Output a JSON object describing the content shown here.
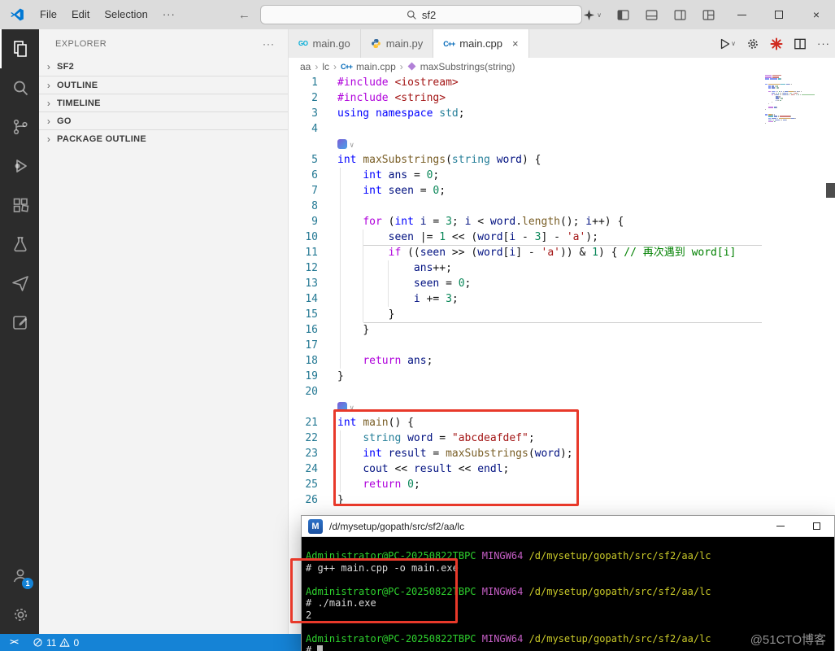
{
  "colors": {
    "accent_red": "#e8392a",
    "status_blue": "#1583d6",
    "activity_bar": "#2c2c2c",
    "term_green": "#2ed22e",
    "term_magenta": "#c75fc7",
    "term_yellow": "#c9c929",
    "term_fg": "#d9d9d9",
    "go_icon": "#00acd7",
    "cpp_icon": "#0068b8"
  },
  "icons": {
    "more": "···",
    "back": "←",
    "forward": "→",
    "close": "×",
    "chevron": "›",
    "crumb_sep": "›",
    "chevron_down": "∨",
    "remote": "><",
    "mingw": "M",
    "go": "GO",
    "cpp": "C++"
  },
  "title_bar": {
    "menus": [
      "File",
      "Edit",
      "Selection"
    ],
    "search_value": "sf2"
  },
  "activity_bar": {
    "badge": "1"
  },
  "sidebar": {
    "header": "EXPLORER",
    "sections": [
      "SF2",
      "OUTLINE",
      "TIMELINE",
      "GO",
      "PACKAGE OUTLINE"
    ]
  },
  "tabs": [
    {
      "label": "main.go"
    },
    {
      "label": "main.py"
    },
    {
      "label": "main.cpp",
      "active": true
    }
  ],
  "breadcrumb": [
    "aa",
    "lc",
    "main.cpp",
    "maxSubstrings(string)"
  ],
  "editor": {
    "rows": [
      {
        "n": 1,
        "t": [
          [
            "dir",
            "#include"
          ],
          [
            "pln",
            " "
          ],
          [
            "str",
            "<iostream>"
          ]
        ]
      },
      {
        "n": 2,
        "t": [
          [
            "dir",
            "#include"
          ],
          [
            "pln",
            " "
          ],
          [
            "str",
            "<string>"
          ]
        ]
      },
      {
        "n": 3,
        "t": [
          [
            "kw",
            "using"
          ],
          [
            "pln",
            " "
          ],
          [
            "kw",
            "namespace"
          ],
          [
            "pln",
            " "
          ],
          [
            "type",
            "std"
          ],
          [
            "pun",
            ";"
          ]
        ]
      },
      {
        "n": 4,
        "t": []
      },
      {
        "lens": true
      },
      {
        "n": 5,
        "t": [
          [
            "kw",
            "int"
          ],
          [
            "pln",
            " "
          ],
          [
            "fn",
            "maxSubstrings"
          ],
          [
            "pun",
            "("
          ],
          [
            "type",
            "string"
          ],
          [
            "pln",
            " "
          ],
          [
            "var",
            "word"
          ],
          [
            "pun",
            ")"
          ],
          [
            "pln",
            " "
          ],
          [
            "pun",
            "{"
          ]
        ]
      },
      {
        "n": 6,
        "t": [
          [
            "pln",
            "    "
          ],
          [
            "kw",
            "int"
          ],
          [
            "pln",
            " "
          ],
          [
            "var",
            "ans"
          ],
          [
            "pln",
            " "
          ],
          [
            "op",
            "="
          ],
          [
            "pln",
            " "
          ],
          [
            "num",
            "0"
          ],
          [
            "pun",
            ";"
          ]
        ]
      },
      {
        "n": 7,
        "t": [
          [
            "pln",
            "    "
          ],
          [
            "kw",
            "int"
          ],
          [
            "pln",
            " "
          ],
          [
            "var",
            "seen"
          ],
          [
            "pln",
            " "
          ],
          [
            "op",
            "="
          ],
          [
            "pln",
            " "
          ],
          [
            "num",
            "0"
          ],
          [
            "pun",
            ";"
          ]
        ]
      },
      {
        "n": 8,
        "t": []
      },
      {
        "n": 9,
        "t": [
          [
            "pln",
            "    "
          ],
          [
            "ctl",
            "for"
          ],
          [
            "pln",
            " "
          ],
          [
            "pun",
            "("
          ],
          [
            "kw",
            "int"
          ],
          [
            "pln",
            " "
          ],
          [
            "var",
            "i"
          ],
          [
            "pln",
            " "
          ],
          [
            "op",
            "="
          ],
          [
            "pln",
            " "
          ],
          [
            "num",
            "3"
          ],
          [
            "pun",
            ";"
          ],
          [
            "pln",
            " "
          ],
          [
            "var",
            "i"
          ],
          [
            "pln",
            " "
          ],
          [
            "op",
            "<"
          ],
          [
            "pln",
            " "
          ],
          [
            "var",
            "word"
          ],
          [
            "pun",
            "."
          ],
          [
            "fn",
            "length"
          ],
          [
            "pun",
            "();"
          ],
          [
            "pln",
            " "
          ],
          [
            "var",
            "i"
          ],
          [
            "op",
            "++"
          ],
          [
            "pun",
            ")"
          ],
          [
            "pln",
            " "
          ],
          [
            "pun",
            "{"
          ]
        ]
      },
      {
        "n": 10,
        "t": [
          [
            "pln",
            "        "
          ],
          [
            "var",
            "seen"
          ],
          [
            "pln",
            " "
          ],
          [
            "op",
            "|="
          ],
          [
            "pln",
            " "
          ],
          [
            "num",
            "1"
          ],
          [
            "pln",
            " "
          ],
          [
            "op",
            "<<"
          ],
          [
            "pln",
            " "
          ],
          [
            "pun",
            "("
          ],
          [
            "var",
            "word"
          ],
          [
            "pun",
            "["
          ],
          [
            "var",
            "i"
          ],
          [
            "pln",
            " "
          ],
          [
            "op",
            "-"
          ],
          [
            "pln",
            " "
          ],
          [
            "num",
            "3"
          ],
          [
            "pun",
            "]"
          ],
          [
            "pln",
            " "
          ],
          [
            "op",
            "-"
          ],
          [
            "pln",
            " "
          ],
          [
            "str",
            "'a'"
          ],
          [
            "pun",
            ");"
          ]
        ]
      },
      {
        "n": 11,
        "t": [
          [
            "pln",
            "        "
          ],
          [
            "ctl",
            "if"
          ],
          [
            "pln",
            " "
          ],
          [
            "pun",
            "(("
          ],
          [
            "var",
            "seen"
          ],
          [
            "pln",
            " "
          ],
          [
            "op",
            ">>"
          ],
          [
            "pln",
            " "
          ],
          [
            "pun",
            "("
          ],
          [
            "var",
            "word"
          ],
          [
            "pun",
            "["
          ],
          [
            "var",
            "i"
          ],
          [
            "pun",
            "]"
          ],
          [
            "pln",
            " "
          ],
          [
            "op",
            "-"
          ],
          [
            "pln",
            " "
          ],
          [
            "str",
            "'a'"
          ],
          [
            "pun",
            "))"
          ],
          [
            "pln",
            " "
          ],
          [
            "op",
            "&"
          ],
          [
            "pln",
            " "
          ],
          [
            "num",
            "1"
          ],
          [
            "pun",
            ")"
          ],
          [
            "pln",
            " "
          ],
          [
            "pun",
            "{"
          ],
          [
            "pln",
            " "
          ],
          [
            "cmt",
            "// 再次遇到 word[i]"
          ]
        ]
      },
      {
        "n": 12,
        "t": [
          [
            "pln",
            "            "
          ],
          [
            "var",
            "ans"
          ],
          [
            "op",
            "++"
          ],
          [
            "pun",
            ";"
          ]
        ]
      },
      {
        "n": 13,
        "t": [
          [
            "pln",
            "            "
          ],
          [
            "var",
            "seen"
          ],
          [
            "pln",
            " "
          ],
          [
            "op",
            "="
          ],
          [
            "pln",
            " "
          ],
          [
            "num",
            "0"
          ],
          [
            "pun",
            ";"
          ]
        ]
      },
      {
        "n": 14,
        "t": [
          [
            "pln",
            "            "
          ],
          [
            "var",
            "i"
          ],
          [
            "pln",
            " "
          ],
          [
            "op",
            "+="
          ],
          [
            "pln",
            " "
          ],
          [
            "num",
            "3"
          ],
          [
            "pun",
            ";"
          ]
        ]
      },
      {
        "n": 15,
        "t": [
          [
            "pln",
            "        "
          ],
          [
            "pun",
            "}"
          ]
        ]
      },
      {
        "n": 16,
        "t": [
          [
            "pln",
            "    "
          ],
          [
            "pun",
            "}"
          ]
        ]
      },
      {
        "n": 17,
        "t": []
      },
      {
        "n": 18,
        "t": [
          [
            "pln",
            "    "
          ],
          [
            "ctl",
            "return"
          ],
          [
            "pln",
            " "
          ],
          [
            "var",
            "ans"
          ],
          [
            "pun",
            ";"
          ]
        ]
      },
      {
        "n": 19,
        "t": [
          [
            "pun",
            "}"
          ]
        ]
      },
      {
        "n": 20,
        "t": []
      },
      {
        "lens": true
      },
      {
        "n": 21,
        "t": [
          [
            "kw",
            "int"
          ],
          [
            "pln",
            " "
          ],
          [
            "fn",
            "main"
          ],
          [
            "pun",
            "()"
          ],
          [
            "pln",
            " "
          ],
          [
            "pun",
            "{"
          ]
        ]
      },
      {
        "n": 22,
        "t": [
          [
            "pln",
            "    "
          ],
          [
            "type",
            "string"
          ],
          [
            "pln",
            " "
          ],
          [
            "var",
            "word"
          ],
          [
            "pln",
            " "
          ],
          [
            "op",
            "="
          ],
          [
            "pln",
            " "
          ],
          [
            "str",
            "\"abcdeafdef\""
          ],
          [
            "pun",
            ";"
          ]
        ]
      },
      {
        "n": 23,
        "t": [
          [
            "pln",
            "    "
          ],
          [
            "kw",
            "int"
          ],
          [
            "pln",
            " "
          ],
          [
            "var",
            "result"
          ],
          [
            "pln",
            " "
          ],
          [
            "op",
            "="
          ],
          [
            "pln",
            " "
          ],
          [
            "fn",
            "maxSubstrings"
          ],
          [
            "pun",
            "("
          ],
          [
            "var",
            "word"
          ],
          [
            "pun",
            ");"
          ]
        ]
      },
      {
        "n": 24,
        "t": [
          [
            "pln",
            "    "
          ],
          [
            "var",
            "cout"
          ],
          [
            "pln",
            " "
          ],
          [
            "op",
            "<<"
          ],
          [
            "pln",
            " "
          ],
          [
            "var",
            "result"
          ],
          [
            "pln",
            " "
          ],
          [
            "op",
            "<<"
          ],
          [
            "pln",
            " "
          ],
          [
            "var",
            "endl"
          ],
          [
            "pun",
            ";"
          ]
        ]
      },
      {
        "n": 25,
        "t": [
          [
            "pln",
            "    "
          ],
          [
            "ctl",
            "return"
          ],
          [
            "pln",
            " "
          ],
          [
            "num",
            "0"
          ],
          [
            "pun",
            ";"
          ]
        ]
      },
      {
        "n": 26,
        "t": [
          [
            "pun",
            "}"
          ]
        ]
      }
    ]
  },
  "terminal": {
    "title": "/d/mysetup/gopath/src/sf2/aa/lc",
    "prompt_user": "Administrator@PC-20250822TBPC",
    "prompt_host": "MINGW64",
    "prompt_path": "/d/mysetup/gopath/src/sf2/aa/lc",
    "lines": [
      {
        "type": "prompt"
      },
      {
        "type": "cmd",
        "text": "# g++ main.cpp -o main.exe"
      },
      {
        "type": "blank"
      },
      {
        "type": "prompt"
      },
      {
        "type": "cmd",
        "text": "# ./main.exe"
      },
      {
        "type": "out",
        "text": "2"
      },
      {
        "type": "blank"
      },
      {
        "type": "prompt"
      },
      {
        "type": "cmd",
        "text": "# ",
        "cursor": true
      }
    ]
  },
  "status_bar": {
    "errors": "11",
    "warnings": "0"
  },
  "watermark": "@51CTO博客"
}
